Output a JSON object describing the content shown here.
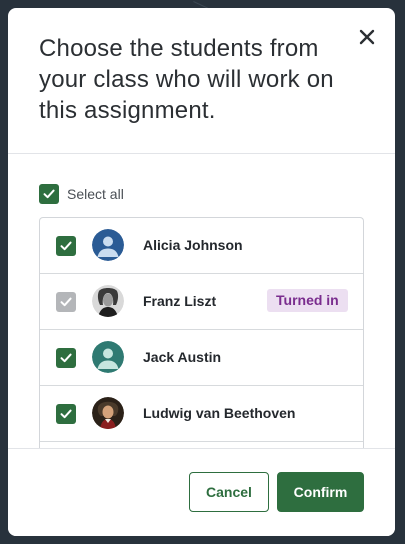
{
  "modal": {
    "title": "Choose the students from your class who will work on this assignment.",
    "close_icon": "close-icon"
  },
  "select_all": {
    "label": "Select all",
    "checked": true
  },
  "students": [
    {
      "name": "Alicia Johnson",
      "checked": true,
      "disabled": false,
      "badge": "",
      "avatar": "default-avatar-blue"
    },
    {
      "name": "Franz Liszt",
      "checked": true,
      "disabled": true,
      "badge": "Turned in",
      "avatar": "portrait-photo"
    },
    {
      "name": "Jack Austin",
      "checked": true,
      "disabled": false,
      "badge": "",
      "avatar": "default-avatar-teal"
    },
    {
      "name": "Ludwig van Beethoven",
      "checked": true,
      "disabled": false,
      "badge": "",
      "avatar": "portrait-photo"
    }
  ],
  "footer": {
    "cancel_label": "Cancel",
    "confirm_label": "Confirm"
  },
  "colors": {
    "primary_green": "#2e6e3f",
    "disabled_checkbox": "#b4b6b9",
    "badge_bg": "#ecdff1",
    "badge_text": "#7a2d8e",
    "avatar_blue": "#2a5b95",
    "avatar_teal": "#2f7a72"
  }
}
